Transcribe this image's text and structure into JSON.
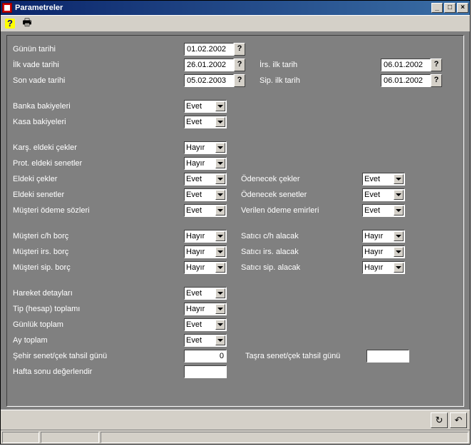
{
  "window": {
    "title": "Parametreler"
  },
  "titlebtns": {
    "min": "_",
    "max": "□",
    "close": "×"
  },
  "toolbar": {
    "help": "?",
    "print": "⎙"
  },
  "labels": {
    "gunun_tarihi": "Günün tarihi",
    "ilk_vade_tarihi": "İlk vade tarihi",
    "son_vade_tarihi": "Son vade tarihi",
    "irs_ilk_tarih": "İrs. ilk tarih",
    "sip_ilk_tarih": "Sip. ilk tarih",
    "banka_bakiyeleri": "Banka bakiyeleri",
    "kasa_bakiyeleri": "Kasa bakiyeleri",
    "kars_eld_cek": "Karş. eldeki çekler",
    "prot_eld_sen": "Prot. eldeki senetler",
    "eldeki_cekler": "Eldeki çekler",
    "eldeki_senetler": "Eldeki senetler",
    "musteri_odeme_sozleri": "Müşteri ödeme sözleri",
    "odenecek_cekler": "Ödenecek çekler",
    "odenecek_senetler": "Ödenecek senetler",
    "verilen_odeme_emirleri": "Verilen ödeme emirleri",
    "musteri_ch_borc": "Müşteri c/h borç",
    "musteri_irs_borc": "Müşteri irs. borç",
    "musteri_sip_borc": "Müşteri sip. borç",
    "satici_ch_alacak": "Satıcı c/h alacak",
    "satici_irs_alacak": "Satıcı irs. alacak",
    "satici_sip_alacak": "Satıcı sip. alacak",
    "hareket_detaylari": "Hareket detayları",
    "tip_hesap_toplami": "Tip (hesap) toplamı",
    "gunluk_toplam": "Günlük toplam",
    "ay_toplam": "Ay toplam",
    "sehir_tahsil": "Şehir senet/çek tahsil günü",
    "tasra_tahsil": "Taşra senet/çek tahsil günü",
    "hafta_sonu": "Hafta sonu değerlendir"
  },
  "values": {
    "gunun_tarihi": "01.02.2002",
    "ilk_vade_tarihi": "26.01.2002",
    "son_vade_tarihi": "05.02.2003",
    "irs_ilk_tarih": "06.01.2002",
    "sip_ilk_tarih": "06.01.2002",
    "banka_bakiyeleri": "Evet",
    "kasa_bakiyeleri": "Evet",
    "kars_eld_cek": "Hayır",
    "prot_eld_sen": "Hayır",
    "eldeki_cekler": "Evet",
    "eldeki_senetler": "Evet",
    "musteri_odeme_sozleri": "Evet",
    "odenecek_cekler": "Evet",
    "odenecek_senetler": "Evet",
    "verilen_odeme_emirleri": "Evet",
    "musteri_ch_borc": "Hayır",
    "musteri_irs_borc": "Hayır",
    "musteri_sip_borc": "Hayır",
    "satici_ch_alacak": "Hayır",
    "satici_irs_alacak": "Hayır",
    "satici_sip_alacak": "Hayır",
    "hareket_detaylari": "Evet",
    "tip_hesap_toplami": "Hayır",
    "gunluk_toplam": "Evet",
    "ay_toplam": "Evet",
    "sehir_tahsil": "0",
    "tasra_tahsil": "",
    "hafta_sonu": ""
  },
  "q": "?",
  "footer": {
    "refresh": "↻",
    "undo": "↶"
  }
}
